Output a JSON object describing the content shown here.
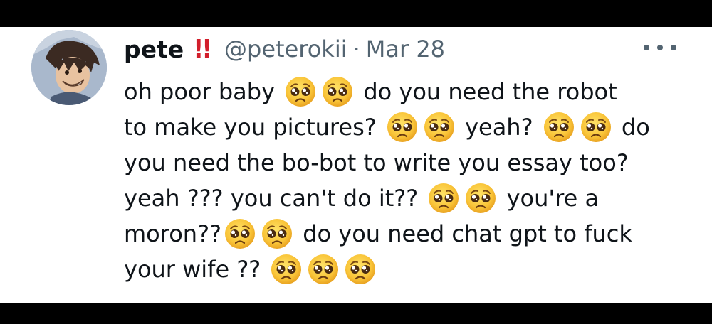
{
  "tweet": {
    "author": {
      "display_name": "pete",
      "emphasis": "!!",
      "handle": "@peterokii",
      "separator": "·",
      "date": "Mar 28"
    },
    "more_icon": "more-horizontal-icon",
    "lines": [
      [
        "oh poor baby ",
        "😳",
        "😳",
        " do you need the robot"
      ],
      [
        "to make you pictures? ",
        "😳",
        "😳",
        " yeah? ",
        "😳",
        "😳",
        " do"
      ],
      [
        "you need the bo-bot to write you essay too?"
      ],
      [
        "yeah ??? you can't do it?? ",
        "😳",
        "😳",
        " you're a"
      ],
      [
        "moron??",
        "😳",
        "😳",
        " do you need chat gpt to fuck"
      ],
      [
        "your wife ?? ",
        "😳",
        "😳",
        "😳"
      ]
    ],
    "text": {
      "l1a": "oh poor baby ",
      "l1b": " do you need the robot",
      "l2a": "to make you pictures? ",
      "l2b": " yeah? ",
      "l2c": " do",
      "l3a": "you need the bo-bot to write you essay too?",
      "l4a": "yeah ??? you can't do it?? ",
      "l4b": " you're a",
      "l5a": "moron??",
      "l5b": " do you need chat gpt to fuck",
      "l6a": "your wife ?? "
    },
    "emoji_icon": "pleading-face-icon",
    "colors": {
      "text": "#0f1419",
      "secondary": "#536471",
      "emphasis": "#d21e2b",
      "emoji_face": "#f9c438"
    }
  }
}
